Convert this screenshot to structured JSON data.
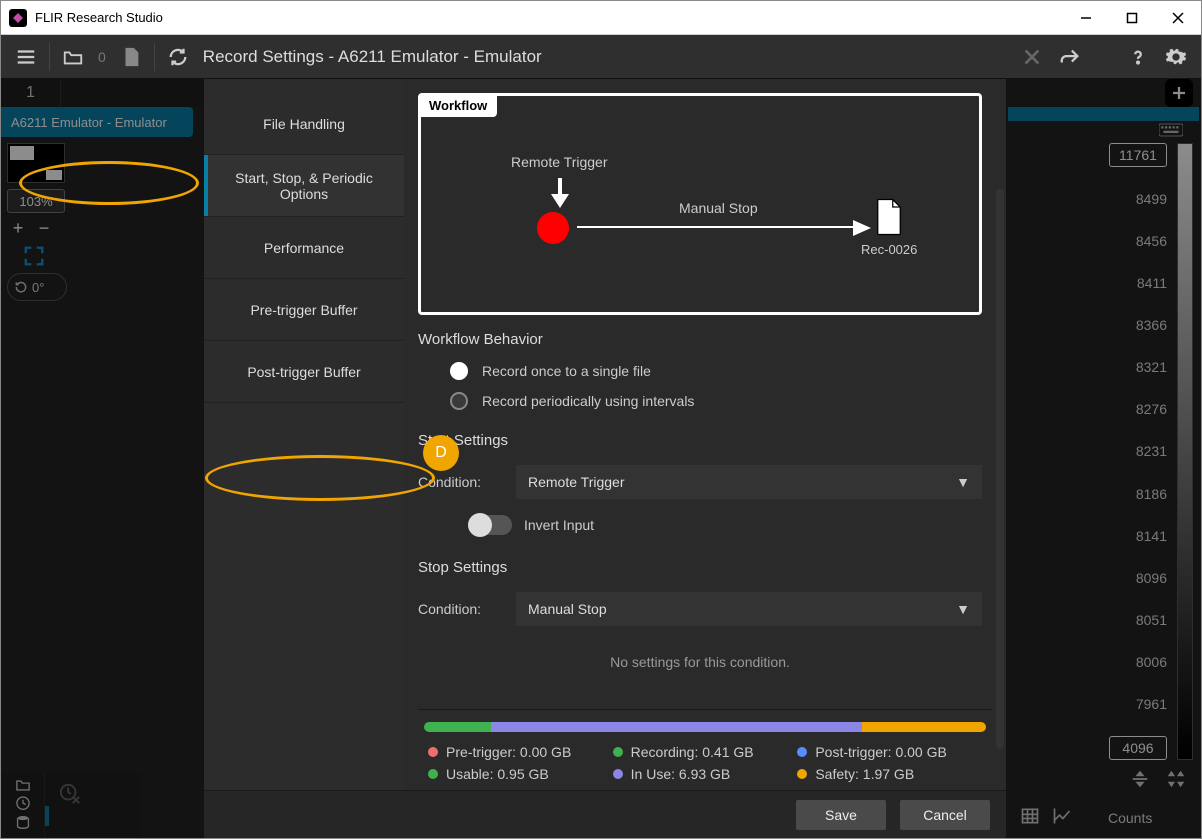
{
  "app": {
    "title": "FLIR Research Studio"
  },
  "toolbar": {
    "open_count": "0"
  },
  "modal": {
    "title": "Record Settings - A6211 Emulator - Emulator",
    "tabs": {
      "file_handling": "File Handling",
      "start_stop": "Start, Stop, & Periodic Options",
      "performance": "Performance",
      "pretrigger": "Pre-trigger Buffer",
      "posttrigger": "Post-trigger Buffer"
    },
    "workflow": {
      "tag": "Workflow",
      "remote_trigger": "Remote Trigger",
      "manual_stop": "Manual Stop",
      "rec_name": "Rec-0026"
    },
    "behavior": {
      "title": "Workflow Behavior",
      "opt1": "Record once to a single file",
      "opt2": "Record periodically using intervals"
    },
    "start": {
      "title": "Start Settings",
      "cond_label": "Condition:",
      "cond_value": "Remote Trigger",
      "invert": "Invert Input"
    },
    "stop": {
      "title": "Stop Settings",
      "cond_label": "Condition:",
      "cond_value": "Manual Stop",
      "none": "No settings for this condition."
    },
    "storage": {
      "pretrigger": "Pre-trigger: 0.00 GB",
      "recording": "Recording: 0.41 GB",
      "posttrigger": "Post-trigger: 0.00 GB",
      "usable": "Usable: 0.95 GB",
      "inuse": "In Use: 6.93 GB",
      "safety": "Safety: 1.97 GB"
    },
    "buttons": {
      "save": "Save",
      "cancel": "Cancel"
    }
  },
  "left": {
    "tab1": "1",
    "source": "A6211 Emulator - Emulator",
    "zoom": "103%",
    "rotate": "0°"
  },
  "right": {
    "top_value": "11761",
    "ticks": [
      "8499",
      "8456",
      "8411",
      "8366",
      "8321",
      "8276",
      "8231",
      "8186",
      "8141",
      "8096",
      "8051",
      "8006",
      "7961"
    ],
    "bottom_value": "4096",
    "counts": "Counts"
  },
  "annotations": {
    "badge": "D"
  },
  "colors": {
    "pretrigger": "#ef6f6f",
    "recording": "#3fb24f",
    "posttrigger": "#5a8cff",
    "usable": "#3fb24f",
    "inuse": "#8a87e6",
    "safety": "#f0a500"
  }
}
